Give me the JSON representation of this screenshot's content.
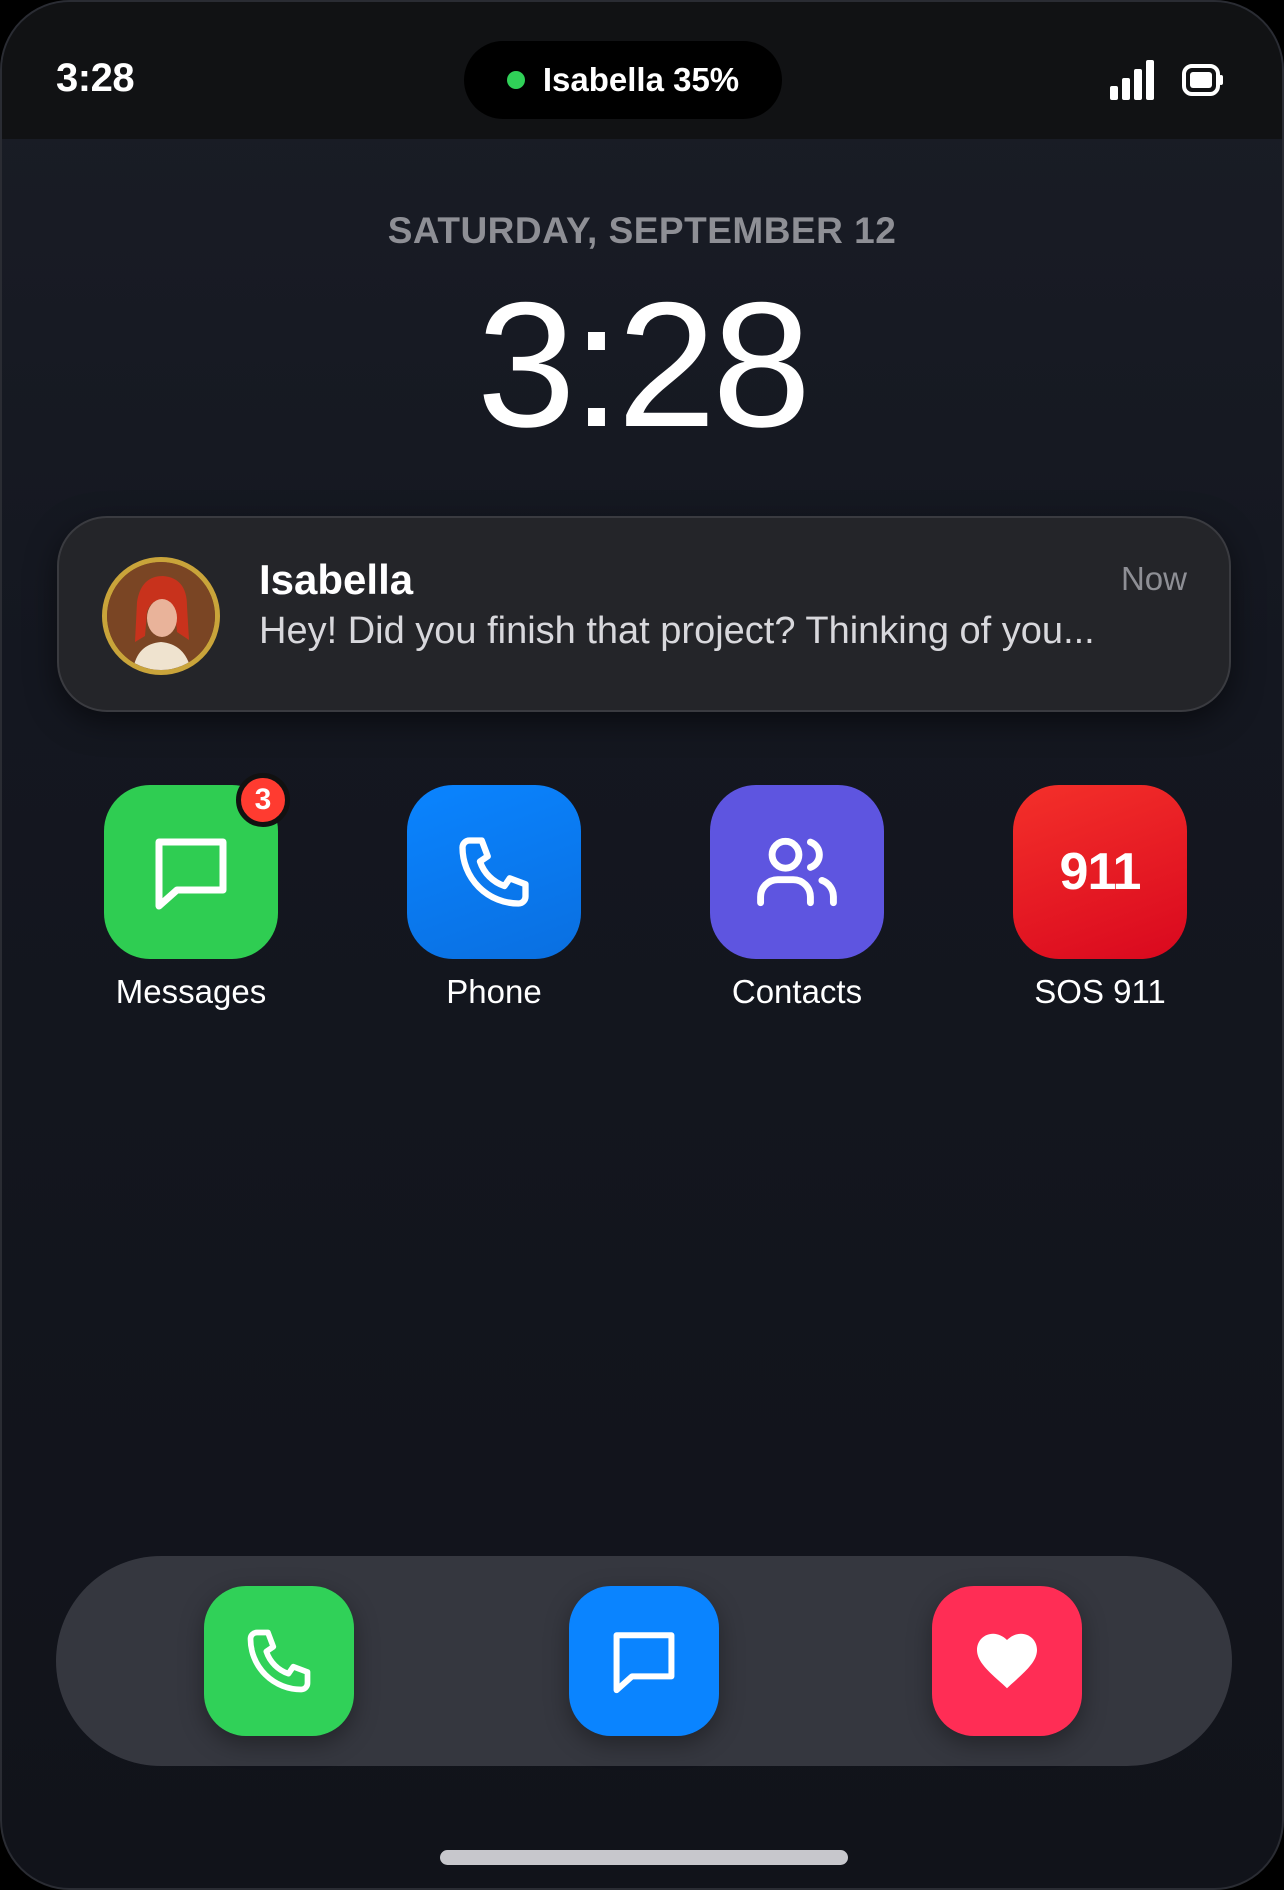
{
  "status_bar": {
    "time": "3:28",
    "live_activity": "Isabella 35%",
    "signal_icon": "cellular-signal-icon",
    "battery_icon": "battery-icon"
  },
  "lock_screen": {
    "date": "SATURDAY, SEPTEMBER 12",
    "time": "3:28"
  },
  "notification": {
    "sender": "Isabella",
    "time": "Now",
    "message": "Hey! Did you finish that project? Thinking of you..."
  },
  "apps": [
    {
      "label": "Messages",
      "icon": "message-bubble-icon",
      "color": "#30d158",
      "badge": "3"
    },
    {
      "label": "Phone",
      "icon": "phone-icon",
      "color": "#0a84ff"
    },
    {
      "label": "Contacts",
      "icon": "people-icon",
      "color": "#5e5ce6"
    },
    {
      "label": "SOS 911",
      "icon_text": "911",
      "color": "#ff3b30"
    }
  ],
  "dock": [
    {
      "icon": "phone-icon",
      "color": "#30d158"
    },
    {
      "icon": "message-bubble-icon",
      "color": "#0a84ff"
    },
    {
      "icon": "heart-icon",
      "color": "#ff2d55"
    }
  ]
}
